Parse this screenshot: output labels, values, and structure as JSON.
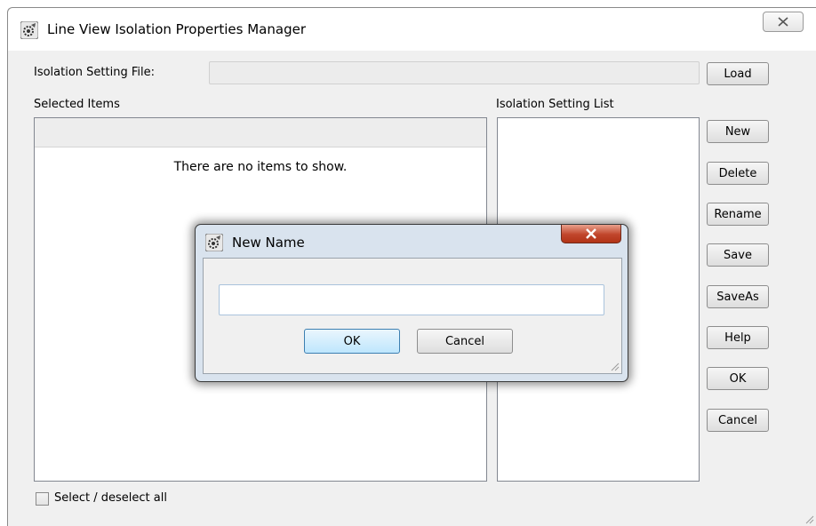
{
  "window": {
    "title": "Line View Isolation Properties Manager",
    "app_icon": "gear-app-icon",
    "close_icon": "close-icon"
  },
  "form": {
    "isolation_setting_file_label": "Isolation Setting File:",
    "isolation_setting_file_value": "",
    "selected_items_label": "Selected Items",
    "empty_message": "There are no items to show.",
    "isolation_setting_list_label": "Isolation Setting List",
    "select_all_label": "Select / deselect all"
  },
  "buttons": {
    "load": "Load",
    "new": "New",
    "delete": "Delete",
    "rename": "Rename",
    "save": "Save",
    "save_as": "SaveAs",
    "help": "Help",
    "ok": "OK",
    "cancel": "Cancel"
  },
  "dialog": {
    "title": "New Name",
    "input_value": "",
    "ok": "OK",
    "cancel": "Cancel"
  },
  "colors": {
    "window_bg": "#f0f0f0",
    "dialog_frame": "#d9e3ee",
    "close_red": "#c0452b",
    "default_button_blue": "#3c7fb1"
  }
}
